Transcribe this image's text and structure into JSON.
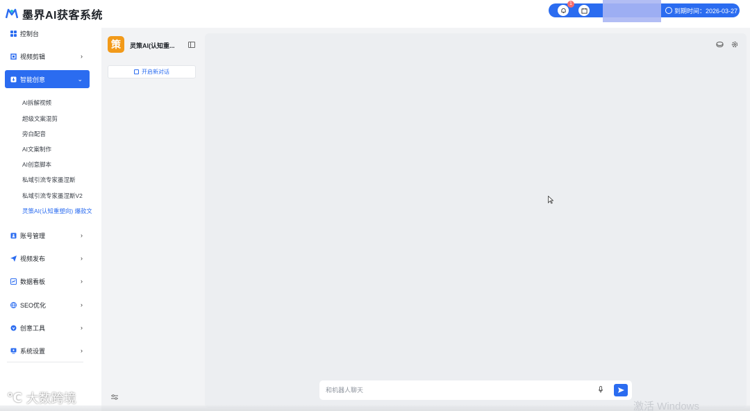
{
  "header": {
    "app_title": "墨界AI获客系统",
    "notification_count": "1",
    "expire_label": "到期时间：2026-03-27"
  },
  "sidebar": {
    "items": [
      {
        "label": "控制台",
        "icon": "grid-icon"
      },
      {
        "label": "视频剪辑",
        "icon": "crop-icon"
      },
      {
        "label": "智能创意",
        "icon": "download-box-icon"
      },
      {
        "label": "账号管理",
        "icon": "id-card-icon"
      },
      {
        "label": "视频发布",
        "icon": "paper-plane-icon"
      },
      {
        "label": "数据看板",
        "icon": "chart-icon"
      },
      {
        "label": "SEO优化",
        "icon": "globe-icon"
      },
      {
        "label": "创意工具",
        "icon": "shield-icon"
      },
      {
        "label": "系统设置",
        "icon": "monitor-icon"
      }
    ],
    "sub_items": [
      "AI拆解视频",
      "超级文案混剪",
      "旁白配音",
      "AI文案制作",
      "AI创意脚本",
      "私域引流专家墨涅斯",
      "私域引流专家墨涅斯V2",
      "灵策AI(认知重塑向) 爆款文"
    ]
  },
  "assistant": {
    "avatar_char": "策",
    "name": "灵策AI(认知重...",
    "new_chat_label": "开启新对话"
  },
  "chat": {
    "input_placeholder": "和机器人聊天"
  },
  "overlay": {
    "watermark": "大数跨境",
    "activate_text": "激活 Windows"
  },
  "colors": {
    "accent": "#2b6cf0",
    "bot_avatar": "#f29a1a",
    "badge": "#f56c6c"
  }
}
